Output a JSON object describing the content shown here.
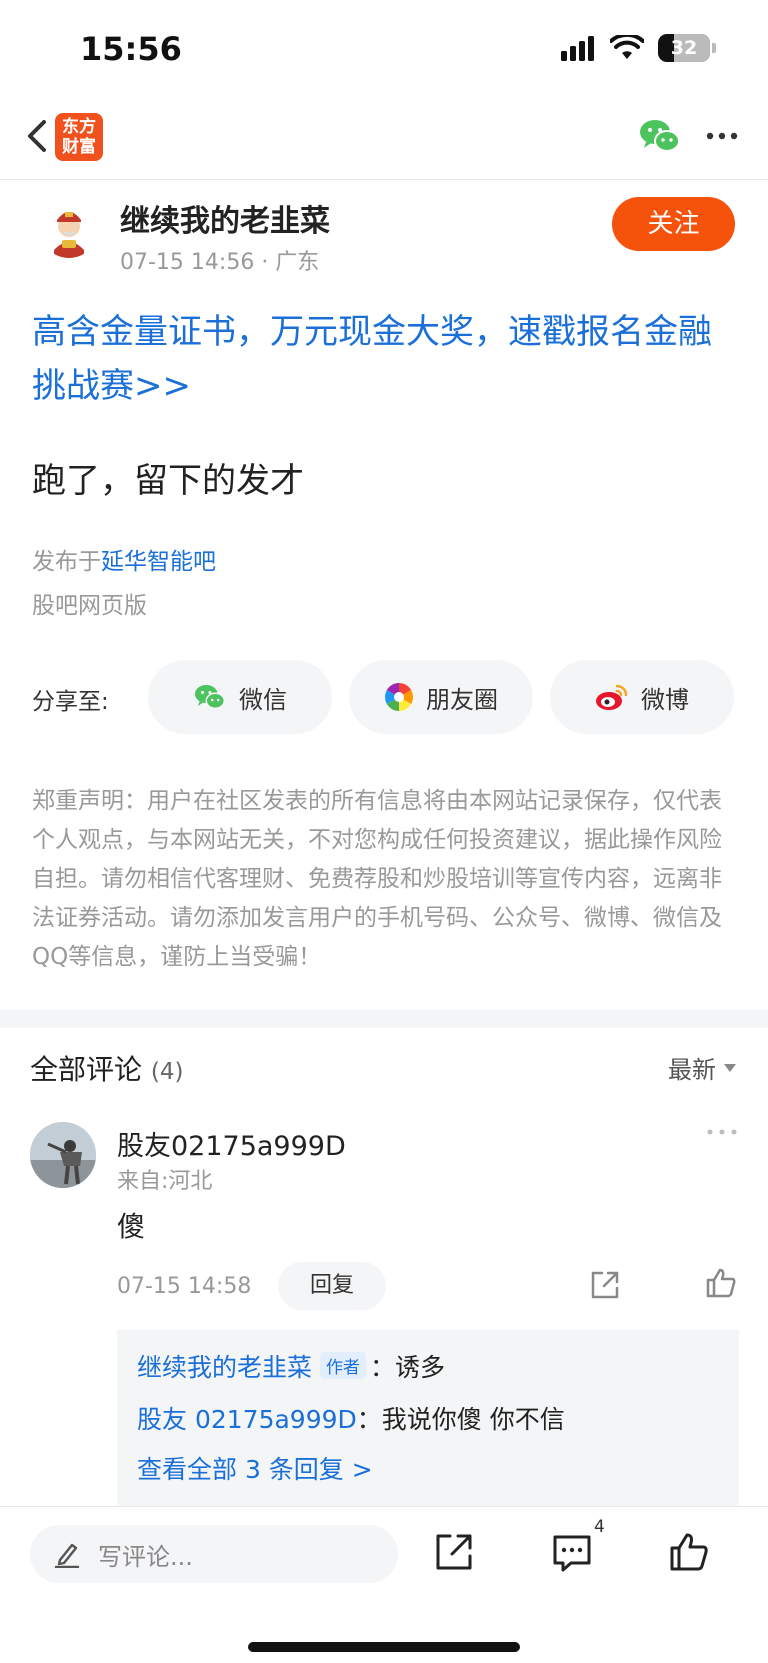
{
  "status": {
    "time": "15:56",
    "battery": "32"
  },
  "nav": {
    "logo_line1": "东方",
    "logo_line2": "财富"
  },
  "author": {
    "name": "继续我的老韭菜",
    "meta": "07-15 14:56 · 广东",
    "follow_label": "关注"
  },
  "post": {
    "promo_link": "高含金量证书，万元现金大奖，速戳报名金融挑战赛>>",
    "body": "跑了，留下的发才",
    "published_prefix": "发布于",
    "bar_name": "延华智能吧",
    "web_version": "股吧网页版"
  },
  "share": {
    "label": "分享至:",
    "options": [
      {
        "label": "微信",
        "icon": "wechat-icon"
      },
      {
        "label": "朋友圈",
        "icon": "moments-icon"
      },
      {
        "label": "微博",
        "icon": "weibo-icon"
      }
    ]
  },
  "disclaimer": "郑重声明：用户在社区发表的所有信息将由本网站记录保存，仅代表个人观点，与本网站无关，不对您构成任何投资建议，据此操作风险自担。请勿相信代客理财、免费荐股和炒股培训等宣传内容，远离非法证券活动。请勿添加发言用户的手机号码、公众号、微博、微信及QQ等信息，谨防上当受骗！",
  "comments": {
    "title": "全部评论",
    "count": "(4)",
    "sort_label": "最新",
    "items": [
      {
        "user": "股友02175a999D",
        "location": "来自:河北",
        "text": "傻",
        "time": "07-15 14:58",
        "reply_label": "回复",
        "replies": [
          {
            "name": "继续我的老韭菜",
            "tag": "作者",
            "sep": "：",
            "text": "诱多"
          },
          {
            "name": "股友 02175a999D",
            "sep": "：",
            "text": "我说你傻 你不信"
          }
        ],
        "view_all": "查看全部 3 条回复 >"
      }
    ]
  },
  "bottom": {
    "placeholder": "写评论...",
    "comment_badge": "4"
  },
  "colors": {
    "accent": "#f5520b",
    "link": "#1a6fd9",
    "muted": "#999999"
  }
}
